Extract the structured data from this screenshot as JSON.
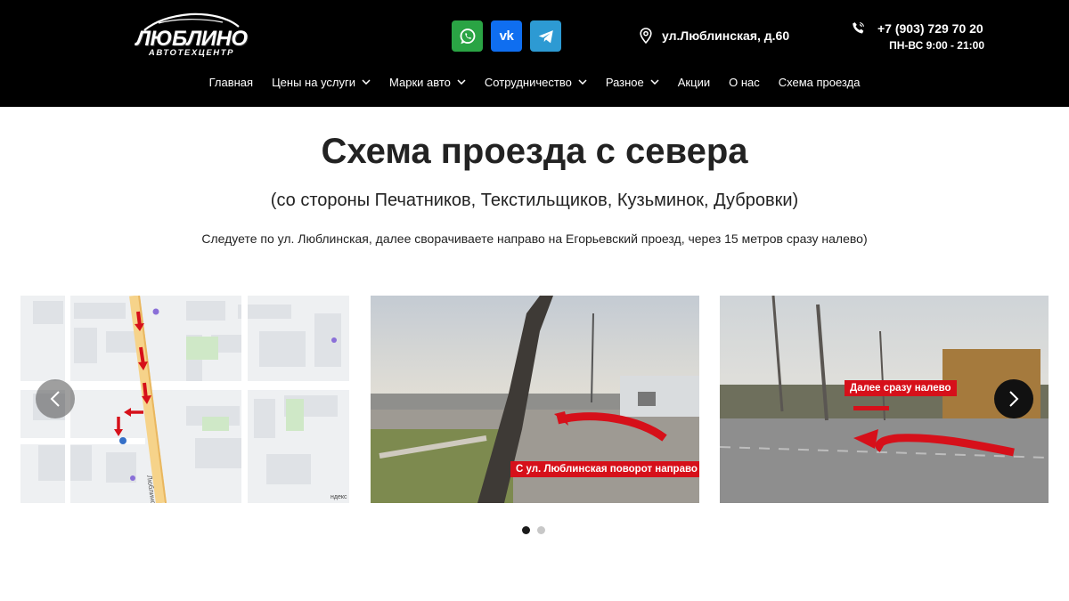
{
  "header": {
    "logo": {
      "word": "ЛЮБЛИНО",
      "sub": "АВТОТЕХЦЕНТР"
    },
    "social": [
      {
        "name": "whatsapp",
        "icon": "whatsapp-icon",
        "color": "#2aa444"
      },
      {
        "name": "vk",
        "icon": "vk-icon",
        "label": "vk",
        "color": "#0f6ef0"
      },
      {
        "name": "telegram",
        "icon": "telegram-icon",
        "color": "#2d9ad3"
      }
    ],
    "address": "ул.Люблинская, д.60",
    "phone": "+7 (903) 729 70 20",
    "hours": "ПН-ВС 9:00 - 21:00"
  },
  "nav": {
    "items": [
      {
        "label": "Главная",
        "dropdown": false
      },
      {
        "label": "Цены на услуги",
        "dropdown": true
      },
      {
        "label": "Марки авто",
        "dropdown": true
      },
      {
        "label": "Сотрудничество",
        "dropdown": true
      },
      {
        "label": "Разное",
        "dropdown": true
      },
      {
        "label": "Акции",
        "dropdown": false
      },
      {
        "label": "О нас",
        "dropdown": false
      },
      {
        "label": "Схема проезда",
        "dropdown": false
      }
    ]
  },
  "main": {
    "title": "Схема проезда с севера",
    "subtitle": "(со стороны Печатников, Текстильщиков, Кузьминок, Дубровки)",
    "description": "Следуете по ул. Люблинская, далее сворачиваете направо на Егорьевский проезд, через 15 метров сразу налево)"
  },
  "slider": {
    "slides": [
      {
        "kind": "map",
        "map_labels": [
          "Люблинская ул.",
          "ндекс"
        ]
      },
      {
        "kind": "photo",
        "caption": "С ул. Люблинская поворот направо"
      },
      {
        "kind": "photo",
        "caption": "Далее сразу налево"
      }
    ],
    "dots": {
      "count": 2,
      "active": 0
    },
    "accent_color": "#d6101a"
  }
}
